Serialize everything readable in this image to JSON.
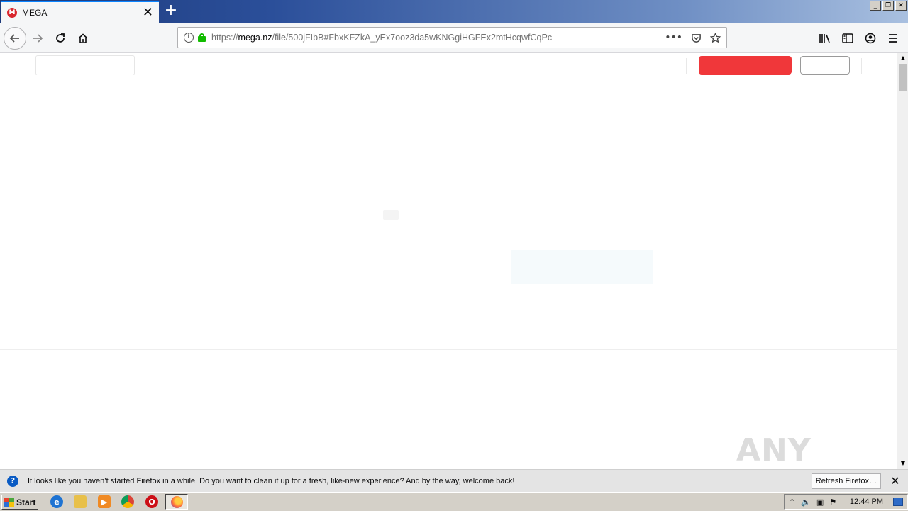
{
  "browser": {
    "tab": {
      "title": "MEGA",
      "favicon": "M",
      "close": "✕"
    },
    "new_tab": "+",
    "window_buttons": [
      "_",
      "❐",
      "✕"
    ],
    "url": {
      "scheme": "https://",
      "host": "mega.nz",
      "path": "/file/500jFIbB#FbxKFZkA_yEx7ooz3da5wKNGgiHGFEx2mtHcqwfCqPc"
    },
    "url_actions": [
      "•••",
      "pocket-icon",
      "star-icon"
    ],
    "toolbar_icons": [
      "library-icon",
      "sidebar-icon",
      "account-icon",
      "menu-icon"
    ]
  },
  "page": {
    "brand_colors": {
      "create_account": "#f0373a",
      "panel": "#f5fafc"
    }
  },
  "watermark": "ANY RUN",
  "notification": {
    "icon": "?",
    "text": "It looks like you haven’t started Firefox in a while. Do you want to clean it up for a fresh, like-new experience? And by the way, welcome back!",
    "button": "Refresh Firefox…",
    "close": "✕"
  },
  "taskbar": {
    "start_label": "Start",
    "clock": "12:44 PM",
    "quick_launch": [
      "internet-explorer-icon",
      "folder-icon",
      "media-player-icon",
      "chrome-icon",
      "opera-icon"
    ],
    "active_task": "firefox-icon"
  }
}
